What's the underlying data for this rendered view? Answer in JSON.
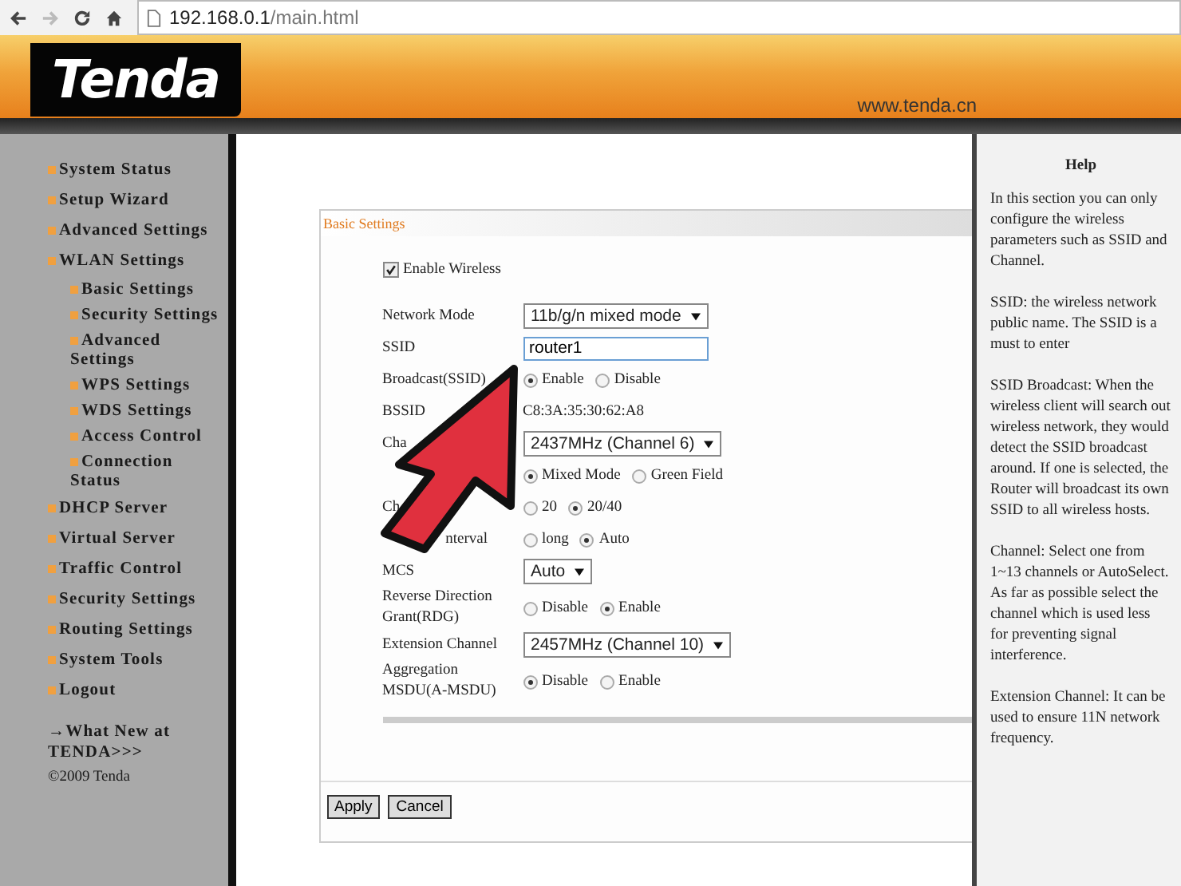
{
  "browser": {
    "address_host": "192.168.0.1",
    "address_path": "/main.html"
  },
  "header": {
    "logo": "Tenda",
    "url": "www.tenda.cn"
  },
  "sidebar": {
    "items": [
      {
        "label": "System Status"
      },
      {
        "label": "Setup Wizard"
      },
      {
        "label": "Advanced Settings"
      },
      {
        "label": "WLAN Settings",
        "children": [
          {
            "label": "Basic Settings"
          },
          {
            "label": "Security Settings"
          },
          {
            "label": "Advanced Settings"
          },
          {
            "label": "WPS Settings"
          },
          {
            "label": "WDS Settings"
          },
          {
            "label": "Access Control"
          },
          {
            "label": "Connection Status"
          }
        ]
      },
      {
        "label": "DHCP Server"
      },
      {
        "label": "Virtual Server"
      },
      {
        "label": "Traffic Control"
      },
      {
        "label": "Security Settings"
      },
      {
        "label": "Routing Settings"
      },
      {
        "label": "System Tools"
      },
      {
        "label": "Logout"
      }
    ],
    "news_link": "→What New at TENDA>>>",
    "copyright": "©2009 Tenda"
  },
  "panel": {
    "title": "Basic Settings",
    "enable_wireless": {
      "label": "Enable Wireless",
      "checked": true
    },
    "rows": [
      {
        "kind": "select",
        "label": "Network Mode",
        "value": "11b/g/n mixed mode"
      },
      {
        "kind": "input",
        "label": "SSID",
        "value": "router1"
      },
      {
        "kind": "radio",
        "label": "Broadcast(SSID)",
        "options": [
          {
            "label": "Enable",
            "selected": true
          },
          {
            "label": "Disable",
            "selected": false
          }
        ]
      },
      {
        "kind": "text",
        "label": "BSSID",
        "value": "C8:3A:35:30:62:A8"
      },
      {
        "kind": "select",
        "label": "Cha",
        "value": "2437MHz (Channel 6)"
      },
      {
        "kind": "radio",
        "options": [
          {
            "label": "Mixed Mode",
            "selected": true
          },
          {
            "label": "Green Field",
            "selected": false
          }
        ]
      },
      {
        "kind": "radio",
        "label": "Ch",
        "options": [
          {
            "label": "20",
            "selected": false
          },
          {
            "label": "20/40",
            "selected": true
          }
        ]
      },
      {
        "kind": "radio",
        "label": "nterval",
        "label_cut": true,
        "options": [
          {
            "label": "long",
            "selected": false
          },
          {
            "label": "Auto",
            "selected": true
          }
        ]
      },
      {
        "kind": "select",
        "label": "MCS",
        "value": "Auto"
      },
      {
        "kind": "radio",
        "label": "Reverse Direction Grant(RDG)",
        "options": [
          {
            "label": "Disable",
            "selected": false
          },
          {
            "label": "Enable",
            "selected": true
          }
        ]
      },
      {
        "kind": "select",
        "label": "Extension Channel",
        "value": "2457MHz (Channel 10)"
      },
      {
        "kind": "radio",
        "label": "Aggregation MSDU(A-MSDU)",
        "options": [
          {
            "label": "Disable",
            "selected": true
          },
          {
            "label": "Enable",
            "selected": false
          }
        ]
      }
    ],
    "buttons": [
      "Apply",
      "Cancel"
    ]
  },
  "help": {
    "title": "Help",
    "paragraphs": [
      "In this section you can only configure the wireless parameters such as SSID and Channel.",
      "SSID: the wireless network public name. The SSID is a must to enter",
      "SSID Broadcast: When the wireless client will search out wireless network, they would detect the SSID broadcast around. If one is selected, the Router will broadcast its own SSID to all wireless hosts.",
      "Channel: Select one from 1~13 channels or AutoSelect. As far as possible select the channel which is used less for preventing signal interference.",
      "Extension Channel: It can be used to ensure 11N network frequency."
    ]
  }
}
